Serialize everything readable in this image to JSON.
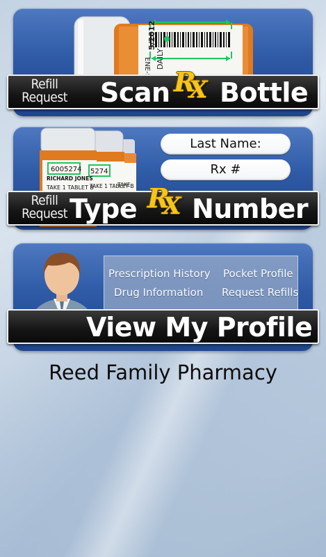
{
  "cards": {
    "scan": {
      "small_label_line1": "Refill",
      "small_label_line2": "Request",
      "title_left": "Scan",
      "title_right": "Bottle",
      "rx_letters": [
        "R",
        "X"
      ],
      "label_text_1": "ENE-SO",
      "label_text_2": "5/2012",
      "label_text_3": "DAILY"
    },
    "type": {
      "small_label_line1": "Refill",
      "small_label_line2": "Request",
      "title_left": "Type",
      "title_right": "Number",
      "rx_letters": [
        "R",
        "X"
      ],
      "field_last_name": "Last Name:",
      "field_rx": "Rx #",
      "bottle_number_1": "6005274",
      "bottle_number_2": "5274",
      "bottle_name": "RICHARD JONES",
      "bottle_instructions": "TAKE 1 TABLET B",
      "bottle_instructions_2": "TAKE 1 TABLET B",
      "bottle_instructions_3": "TAKE"
    },
    "profile": {
      "title": "View My Profile",
      "menu": [
        "Prescription History",
        "Pocket Profile",
        "Drug Information",
        "Request Refills"
      ]
    }
  },
  "footer": {
    "pharmacy_name": "Reed Family Pharmacy"
  },
  "colors": {
    "card_blue": "#2f5aa6",
    "rx_yellow": "#f6c51b",
    "scan_bracket_green": "#22c55e"
  }
}
